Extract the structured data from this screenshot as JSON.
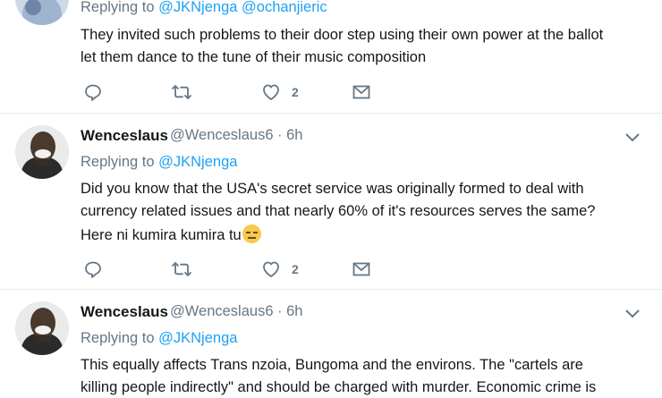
{
  "tweets": [
    {
      "replying_prefix": "Replying to ",
      "mentions": "@JKNjenga @ochanjieric",
      "lines": [
        "They invited such problems to their door step using their own power at the ballot",
        "let them dance to the tune of their music composition"
      ],
      "likes": "2"
    },
    {
      "author": "Wenceslaus",
      "handle": "@Wenceslaus6",
      "time": "· 6h",
      "replying_prefix": "Replying to ",
      "mentions": "@JKNjenga",
      "lines": [
        "Did you know that the USA's secret service was originally formed to deal with",
        "currency related issues and that nearly 60% of it's resources serves the same?",
        "Here ni kumira kumira tu"
      ],
      "emoji": "expressionless-face",
      "likes": "2"
    },
    {
      "author": "Wenceslaus",
      "handle": "@Wenceslaus6",
      "time": "· 6h",
      "replying_prefix": "Replying to ",
      "mentions": "@JKNjenga",
      "lines": [
        "This equally affects Trans nzoia, Bungoma and the environs. The \"cartels are",
        "killing people indirectly\" and should be charged with murder.  Economic crime is"
      ]
    }
  ],
  "icons": {
    "reply": "reply-icon",
    "retweet": "retweet-icon",
    "like": "heart-icon",
    "dm": "envelope-icon",
    "menu": "chevron-down-icon"
  },
  "colors": {
    "link": "#1da1f2",
    "secondary": "#657786",
    "text": "#14171a",
    "divider": "#e6ecf0"
  }
}
